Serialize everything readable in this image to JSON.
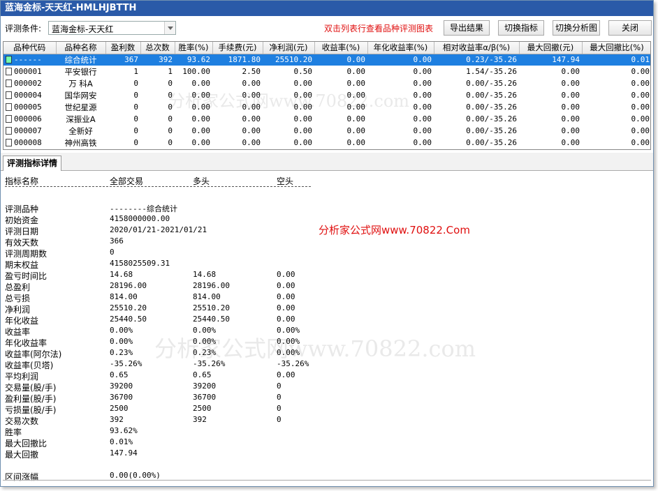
{
  "window": {
    "title": "蓝海金标-天天红-HMLHJBTTH"
  },
  "toolbar": {
    "condition_label": "评测条件:",
    "condition_value": "蓝海金标-天天红",
    "hint": "双击列表行查看品种评测图表",
    "export_label": "导出结果",
    "switch_indicator_label": "切换指标",
    "switch_chart_label": "切换分析图",
    "close_label": "关闭"
  },
  "table": {
    "columns": [
      "品种代码",
      "品种名称",
      "盈利数",
      "总次数",
      "胜率(%)",
      "手续费(元)",
      "净利润(元)",
      "收益率(%)",
      "年化收益率(%)",
      "相对收益率α/β(%)",
      "最大回撤(元)",
      "最大回撤比(%)"
    ],
    "rows": [
      {
        "code": "------",
        "name": "综合统计",
        "wins": "367",
        "total": "392",
        "winrate": "93.62",
        "fee": "1871.80",
        "profit": "25510.20",
        "ret": "0.00",
        "annual": "0.00",
        "relative": "0.23/-35.26",
        "maxdd": "147.94",
        "maxddr": "0.01"
      },
      {
        "code": "000001",
        "name": "平安银行",
        "wins": "1",
        "total": "1",
        "winrate": "100.00",
        "fee": "2.50",
        "profit": "0.50",
        "ret": "0.00",
        "annual": "0.00",
        "relative": "1.54/-35.26",
        "maxdd": "0.00",
        "maxddr": "0.00"
      },
      {
        "code": "000002",
        "name": "万 科A",
        "wins": "0",
        "total": "0",
        "winrate": "0.00",
        "fee": "0.00",
        "profit": "0.00",
        "ret": "0.00",
        "annual": "0.00",
        "relative": "0.00/-35.26",
        "maxdd": "0.00",
        "maxddr": "0.00"
      },
      {
        "code": "000004",
        "name": "国华网安",
        "wins": "0",
        "total": "0",
        "winrate": "0.00",
        "fee": "0.00",
        "profit": "0.00",
        "ret": "0.00",
        "annual": "0.00",
        "relative": "0.00/-35.26",
        "maxdd": "0.00",
        "maxddr": "0.00"
      },
      {
        "code": "000005",
        "name": "世纪星源",
        "wins": "0",
        "total": "0",
        "winrate": "0.00",
        "fee": "0.00",
        "profit": "0.00",
        "ret": "0.00",
        "annual": "0.00",
        "relative": "0.00/-35.26",
        "maxdd": "0.00",
        "maxddr": "0.00"
      },
      {
        "code": "000006",
        "name": "深振业A",
        "wins": "0",
        "total": "0",
        "winrate": "0.00",
        "fee": "0.00",
        "profit": "0.00",
        "ret": "0.00",
        "annual": "0.00",
        "relative": "0.00/-35.26",
        "maxdd": "0.00",
        "maxddr": "0.00"
      },
      {
        "code": "000007",
        "name": "全新好",
        "wins": "0",
        "total": "0",
        "winrate": "0.00",
        "fee": "0.00",
        "profit": "0.00",
        "ret": "0.00",
        "annual": "0.00",
        "relative": "0.00/-35.26",
        "maxdd": "0.00",
        "maxddr": "0.00"
      },
      {
        "code": "000008",
        "name": "神州高铁",
        "wins": "0",
        "total": "0",
        "winrate": "0.00",
        "fee": "0.00",
        "profit": "0.00",
        "ret": "0.00",
        "annual": "0.00",
        "relative": "0.00/-35.26",
        "maxdd": "0.00",
        "maxddr": "0.00"
      }
    ]
  },
  "detail": {
    "tab_label": "评测指标详情",
    "headers": [
      "指标名称",
      "全部交易",
      "多头",
      "空头"
    ],
    "rows": [
      [
        "",
        "",
        "",
        ""
      ],
      [
        "评测品种",
        "--------综合统计",
        "",
        ""
      ],
      [
        "初始资金",
        "4158000000.00",
        "",
        ""
      ],
      [
        "评测日期",
        "2020/01/21-2021/01/21",
        "",
        ""
      ],
      [
        "有效天数",
        "366",
        "",
        ""
      ],
      [
        "评测周期数",
        "0",
        "",
        ""
      ],
      [
        "期末权益",
        "4158025509.31",
        "",
        ""
      ],
      [
        "盈亏时间比",
        "14.68",
        "14.68",
        "0.00"
      ],
      [
        "总盈利",
        "28196.00",
        "28196.00",
        "0.00"
      ],
      [
        "总亏损",
        "814.00",
        "814.00",
        "0.00"
      ],
      [
        "净利润",
        "25510.20",
        "25510.20",
        "0.00"
      ],
      [
        "年化收益",
        "25440.50",
        "25440.50",
        "0.00"
      ],
      [
        "收益率",
        "0.00%",
        "0.00%",
        "0.00%"
      ],
      [
        "年化收益率",
        "0.00%",
        "0.00%",
        "0.00%"
      ],
      [
        "收益率(阿尔法)",
        "0.23%",
        "0.23%",
        "0.00%"
      ],
      [
        "收益率(贝塔)",
        "-35.26%",
        "-35.26%",
        "-35.26%"
      ],
      [
        "平均利润",
        "0.65",
        "0.65",
        "0.00"
      ],
      [
        "交易量(股/手)",
        "39200",
        "39200",
        "0"
      ],
      [
        "盈利量(股/手)",
        "36700",
        "36700",
        "0"
      ],
      [
        "亏损量(股/手)",
        "2500",
        "2500",
        "0"
      ],
      [
        "交易次数",
        "392",
        "392",
        "0"
      ],
      [
        "胜率",
        "93.62%",
        "",
        ""
      ],
      [
        "最大回撤比",
        "0.01%",
        "",
        ""
      ],
      [
        "最大回撤",
        "147.94",
        "",
        ""
      ],
      [
        "",
        "",
        "",
        ""
      ],
      [
        "区间涨幅",
        "0.00(0.00%)",
        "",
        ""
      ]
    ]
  },
  "watermarks": {
    "top": "分析家公式网www.70822.com",
    "red": "分析家公式网www.70822.Com",
    "bottom": "分析家公式网www.70822.com"
  }
}
